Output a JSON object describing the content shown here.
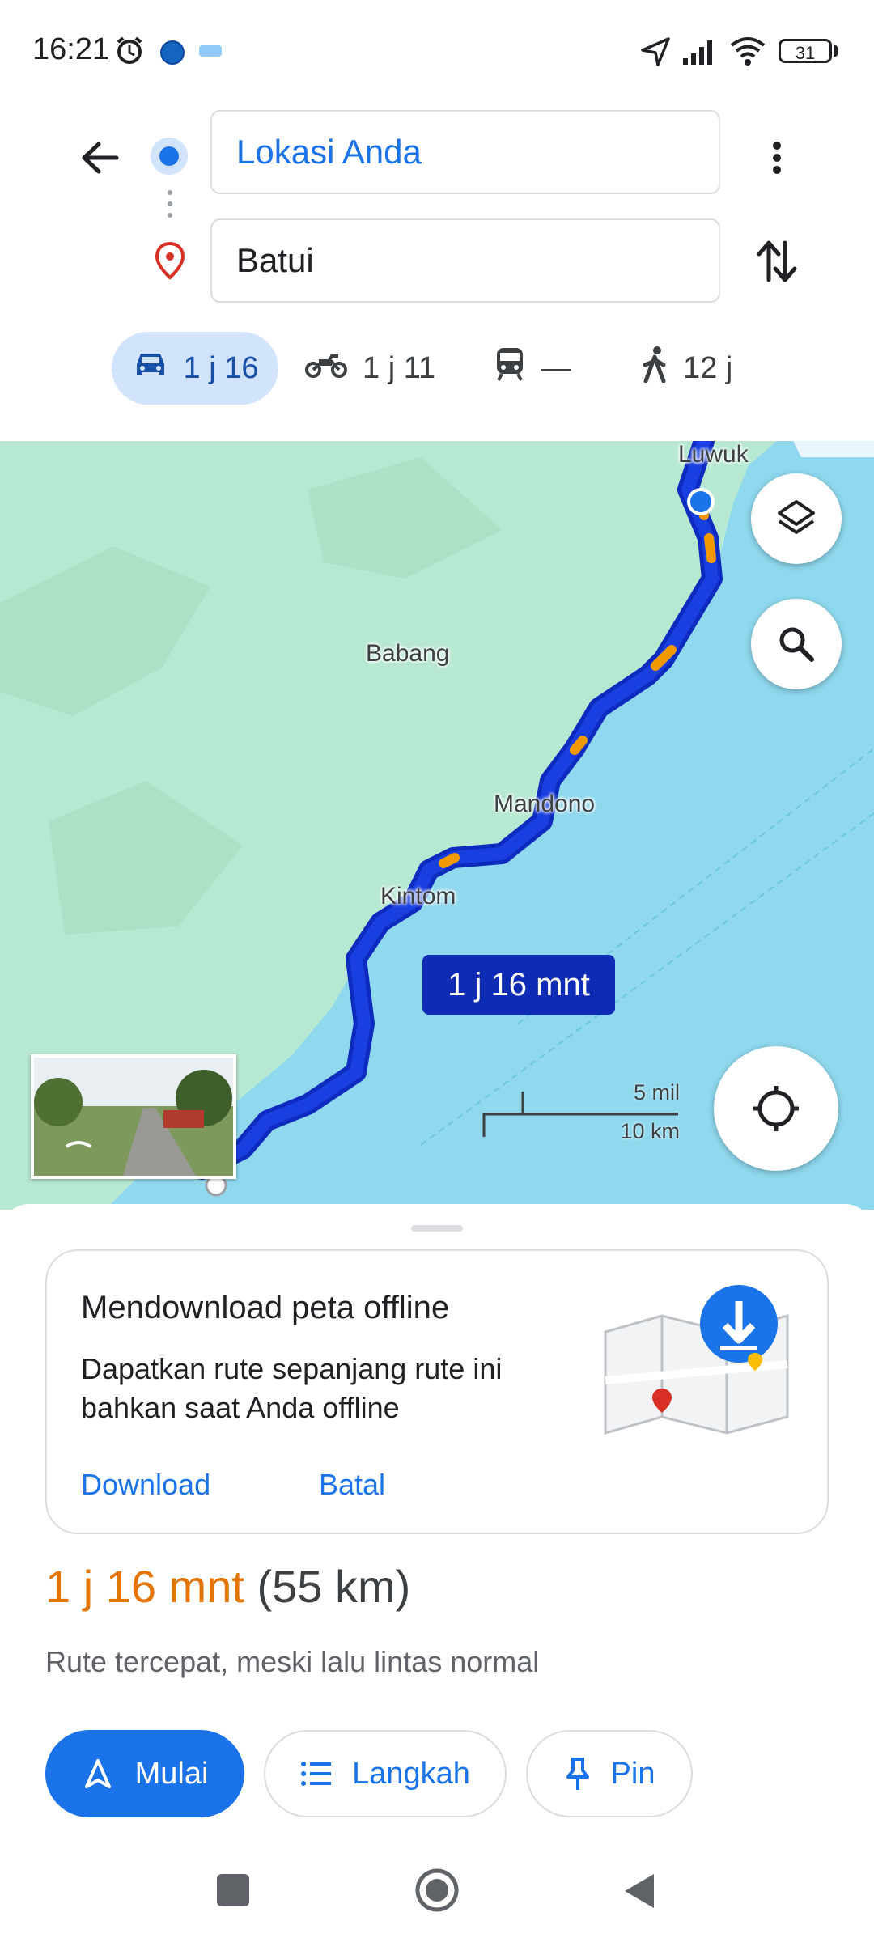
{
  "status_bar": {
    "time": "16:21",
    "battery": "31"
  },
  "search": {
    "origin": "Lokasi Anda",
    "destination": "Batui"
  },
  "modes": [
    {
      "icon": "car-icon",
      "label": "1 j 16",
      "selected": true
    },
    {
      "icon": "motorcycle-icon",
      "label": "1 j 11",
      "selected": false
    },
    {
      "icon": "transit-icon",
      "label": "—",
      "selected": false
    },
    {
      "icon": "walk-icon",
      "label": "12 j",
      "selected": false
    }
  ],
  "map": {
    "labels": [
      "Luwuk",
      "Babang",
      "Mandono",
      "Kintom"
    ],
    "route_callout": "1 j 16 mnt",
    "scale": {
      "top": "5 mil",
      "bottom": "10 km"
    }
  },
  "offline_card": {
    "title": "Mendownload peta offline",
    "body": "Dapatkan rute sepanjang rute ini bahkan saat Anda offline",
    "download_label": "Download",
    "cancel_label": "Batal"
  },
  "route": {
    "duration": "1 j 16 mnt",
    "distance": "(55 km)",
    "description": "Rute tercepat, meski lalu lintas normal"
  },
  "actions": {
    "start_label": "Mulai",
    "steps_label": "Langkah",
    "pin_label": "Pin"
  },
  "colors": {
    "accent": "#1a73e8",
    "route": "#1a3fe0",
    "traffic": "#f29900",
    "water": "#8fd8ee",
    "land": "#b7e8d2",
    "duration": "#e37400"
  }
}
